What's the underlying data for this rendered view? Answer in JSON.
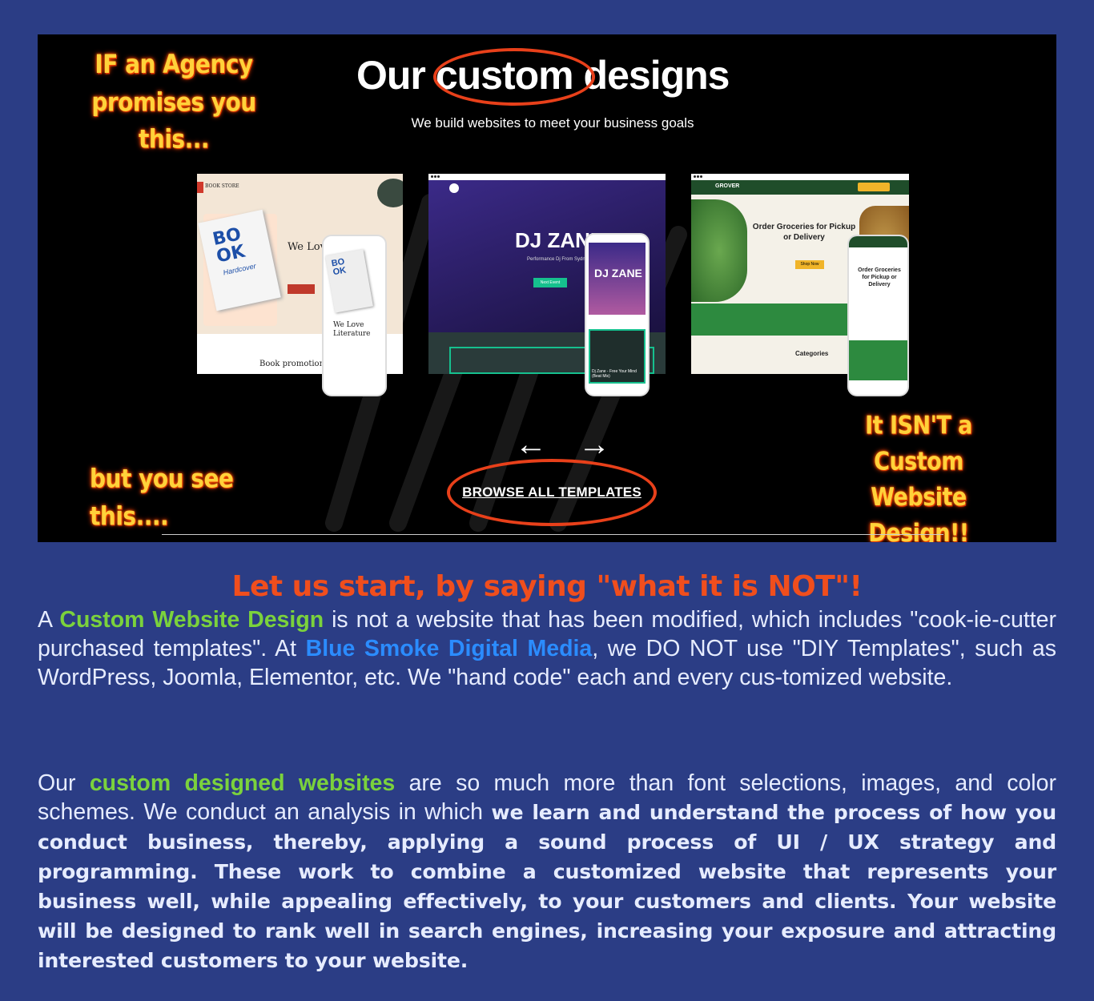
{
  "hero": {
    "callout_top_left": "IF an Agency promises you this...",
    "callout_bottom_left": "but you see this....",
    "callout_bottom_right": "It ISN'T a Custom Website Design!!",
    "title_part1": "Our",
    "title_circled": "custom",
    "title_part2": "designs",
    "subtitle": "We build websites to meet your business goals",
    "arrows": "← →",
    "browse_label": "BROWSE ALL TEMPLATES",
    "mockups": {
      "book": {
        "brand": "BOOK STORE",
        "cover": "BO OK",
        "cover_sub": "Hardcover",
        "heading": "We Love",
        "phone_heading": "We Love Literature",
        "bottom": "Book promotions"
      },
      "dj": {
        "title": "DJ ZANE",
        "tagline": "Performance Dj From Sydney",
        "button": "Next Event",
        "phone_title": "DJ ZANE",
        "phone_track": "Dj Zane - Free Your Mind (Beat Mix)"
      },
      "grocery": {
        "brand": "GROVER",
        "heading": "Order Groceries for Pickup or Delivery",
        "button": "Shop Now",
        "section": "Categories",
        "phone_heading": "Order Groceries for Pickup or Delivery"
      }
    }
  },
  "content": {
    "headline": "Let us start, by saying \"what it is NOT\"!",
    "p1": {
      "t1": "A ",
      "hl1": "Custom Website Design",
      "t2": " is not a website that has been modified, which includes \"cook-ie-cutter purchased templates\". At ",
      "hl2": "Blue Smoke Digital Media",
      "t3": ", we DO NOT use \"DIY Templates\", such as WordPress, Joomla, Elementor, etc. We \"hand code\" each and every cus-tomized website."
    },
    "p2": {
      "t1": "Our ",
      "hl1": "custom designed websites",
      "t2": " are so much more than font selections, images, and color schemes. We conduct an analysis in which ",
      "bold": "we learn and understand the process of how you conduct business, thereby, applying a sound process of UI / UX strategy and programming. These work to combine a customized website that represents your business well, while appealing effectively, to your customers and clients. Your website will be designed to rank well in search engines, increasing your exposure and attracting interested customers to your website."
    }
  },
  "colors": {
    "background": "#2b3d85",
    "headline": "#f04e1d",
    "highlight_green": "#7bd23c",
    "highlight_blue": "#2b8cff",
    "callout": "#ffd23a",
    "circle": "#e8401a"
  }
}
